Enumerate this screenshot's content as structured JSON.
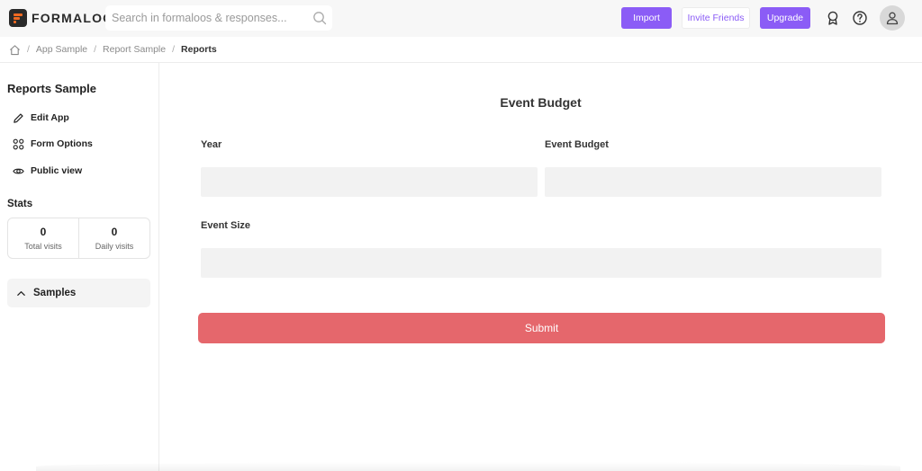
{
  "app": {
    "logo_text": "FORMALOO",
    "colors": {
      "accent": "#8b5cf6",
      "logo_orange": "#f06a22",
      "submit": "#e5676c"
    }
  },
  "search": {
    "placeholder": "Search in formaloos & responses...",
    "value": "",
    "icon": "search-icon"
  },
  "topbar": {
    "import_label": "Import",
    "invite_label": "Invite Friends",
    "upgrade_label": "Upgrade",
    "icons": [
      "award-icon",
      "help-icon",
      "user-icon"
    ]
  },
  "breadcrumb": {
    "home_icon": "home-icon",
    "items": [
      "App Sample",
      "Report Sample",
      "Reports"
    ]
  },
  "sidebar": {
    "title": "Reports Sample",
    "items": [
      {
        "label": "Edit App",
        "icon": "pencil-icon"
      },
      {
        "label": "Form Options",
        "icon": "grid-dots-icon"
      },
      {
        "label": "Public view",
        "icon": "eye-icon"
      }
    ],
    "stats_title": "Stats",
    "stats": [
      {
        "value": "0",
        "label": "Total visits"
      },
      {
        "value": "0",
        "label": "Daily visits"
      }
    ],
    "samples_label": "Samples"
  },
  "form": {
    "title": "Event Budget",
    "fields": [
      {
        "label": "Year",
        "value": ""
      },
      {
        "label": "Event Budget",
        "value": ""
      },
      {
        "label": "Event Size",
        "value": ""
      }
    ],
    "submit_label": "Submit"
  }
}
